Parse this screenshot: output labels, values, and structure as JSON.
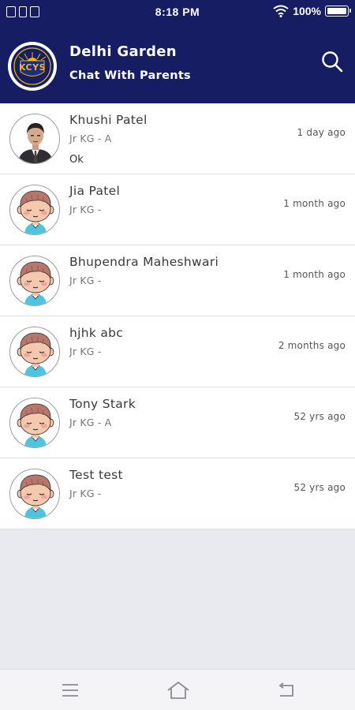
{
  "status_bar": {
    "time": "8:18 PM",
    "battery": "100%",
    "battery_level": 1.0
  },
  "app_bar": {
    "title": "Delhi Garden",
    "subtitle": "Chat With Parents",
    "logo_text": "KCYS"
  },
  "colors": {
    "header_bg": "#161d63",
    "logo_gold": "#f2b705",
    "avatar_skin": "#f4c9ad",
    "avatar_hair": "#b7776a",
    "avatar_shirt": "#4fc3e0"
  },
  "contacts": [
    {
      "name": "Khushi Patel",
      "class": "Jr KG - A",
      "time": "1 day ago",
      "last_message": "Ok",
      "avatar": "man-in-suit-photo"
    },
    {
      "name": "Jia Patel",
      "class": "Jr KG -",
      "time": "1 month ago",
      "last_message": "",
      "avatar": "cartoon-boy-avatar"
    },
    {
      "name": "Bhupendra Maheshwari",
      "class": "Jr KG -",
      "time": "1 month ago",
      "last_message": "",
      "avatar": "cartoon-boy-avatar"
    },
    {
      "name": "hjhk abc",
      "class": "Jr KG -",
      "time": "2 months ago",
      "last_message": "",
      "avatar": "cartoon-boy-avatar"
    },
    {
      "name": "Tony Stark",
      "class": "Jr KG - A",
      "time": "52 yrs ago",
      "last_message": "",
      "avatar": "cartoon-boy-avatar"
    },
    {
      "name": "Test test",
      "class": "Jr KG -",
      "time": "52 yrs ago",
      "last_message": "",
      "avatar": "cartoon-boy-avatar"
    }
  ],
  "nav": {
    "icons": [
      "menu-icon",
      "home-icon",
      "back-icon"
    ]
  }
}
